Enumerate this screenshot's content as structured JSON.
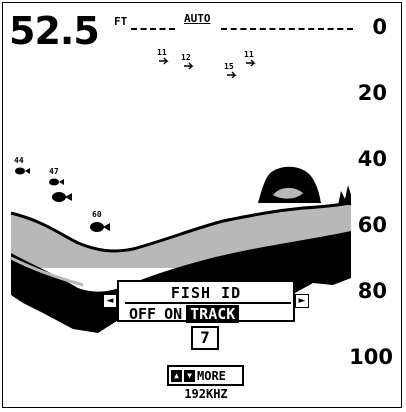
{
  "readout": {
    "depth": "52.5",
    "unit": "FT",
    "range_mode": "AUTO"
  },
  "depth_scale": [
    "0",
    "20",
    "40",
    "60",
    "80",
    "100"
  ],
  "fish_symbols": [
    {
      "depth": "11"
    },
    {
      "depth": "12"
    },
    {
      "depth": "15"
    },
    {
      "depth": "11"
    },
    {
      "depth": "44"
    },
    {
      "depth": "47"
    },
    {
      "depth": ""
    },
    {
      "depth": "60"
    }
  ],
  "fish_id_menu": {
    "title": "FISH ID",
    "options": [
      "OFF",
      "ON",
      "TRACK"
    ],
    "selected": "TRACK",
    "value": "7",
    "left_arrow": "◄",
    "right_arrow": "►"
  },
  "more": {
    "label": "MORE",
    "up_key": "▲",
    "down_key": "▼"
  },
  "frequency": "192KHZ",
  "colors": {
    "background": "#ffffff",
    "foreground": "#000000",
    "return_gray": "#b8b8b8"
  }
}
